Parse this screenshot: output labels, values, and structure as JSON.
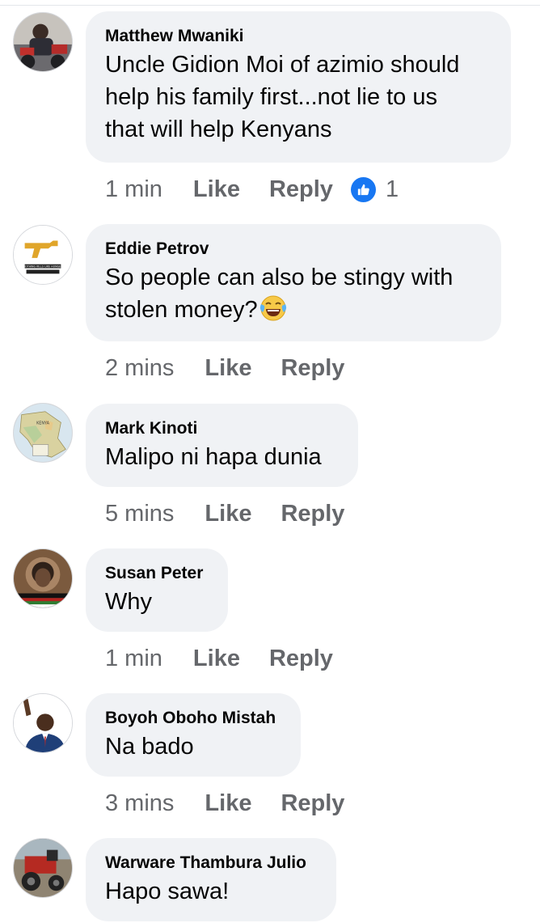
{
  "comments": [
    {
      "author": "Matthew Mwaniki",
      "text_lines": [
        "Uncle Gidion Moi of azimio should",
        "help his family first...not lie to us",
        "that will help Kenyans"
      ],
      "time": "1 min",
      "like_label": "Like",
      "reply_label": "Reply",
      "reaction_count": "1",
      "avatar": "person-photo"
    },
    {
      "author": "Eddie Petrov",
      "text_lines": [
        "So people can also be stingy with",
        "stolen money?"
      ],
      "emoji": "face-with-tears-of-joy-icon",
      "time": "2 mins",
      "like_label": "Like",
      "reply_label": "Reply",
      "avatar": "gun-logo",
      "avatar_text": "NOTHING KILLS LIKE HUNGER"
    },
    {
      "author": "Mark Kinoti",
      "text_lines": [
        "Malipo ni hapa dunia"
      ],
      "time": "5 mins",
      "like_label": "Like",
      "reply_label": "Reply",
      "avatar": "kenya-map",
      "avatar_text": "KENYA"
    },
    {
      "author": "Susan Peter",
      "text_lines": [
        "Why"
      ],
      "time": "1 min",
      "like_label": "Like",
      "reply_label": "Reply",
      "avatar": "portrait-photo"
    },
    {
      "author": "Boyoh Oboho Mistah",
      "text_lines": [
        "Na bado"
      ],
      "time": "3 mins",
      "like_label": "Like",
      "reply_label": "Reply",
      "avatar": "man-waving-photo"
    },
    {
      "author": "Warware Thambura Julio",
      "text_lines": [
        "Hapo sawa!"
      ],
      "avatar": "tractor-photo"
    }
  ],
  "colors": {
    "bubble_bg": "#f0f2f5",
    "meta_text": "#65676b",
    "like_reaction": "#1877f2"
  }
}
